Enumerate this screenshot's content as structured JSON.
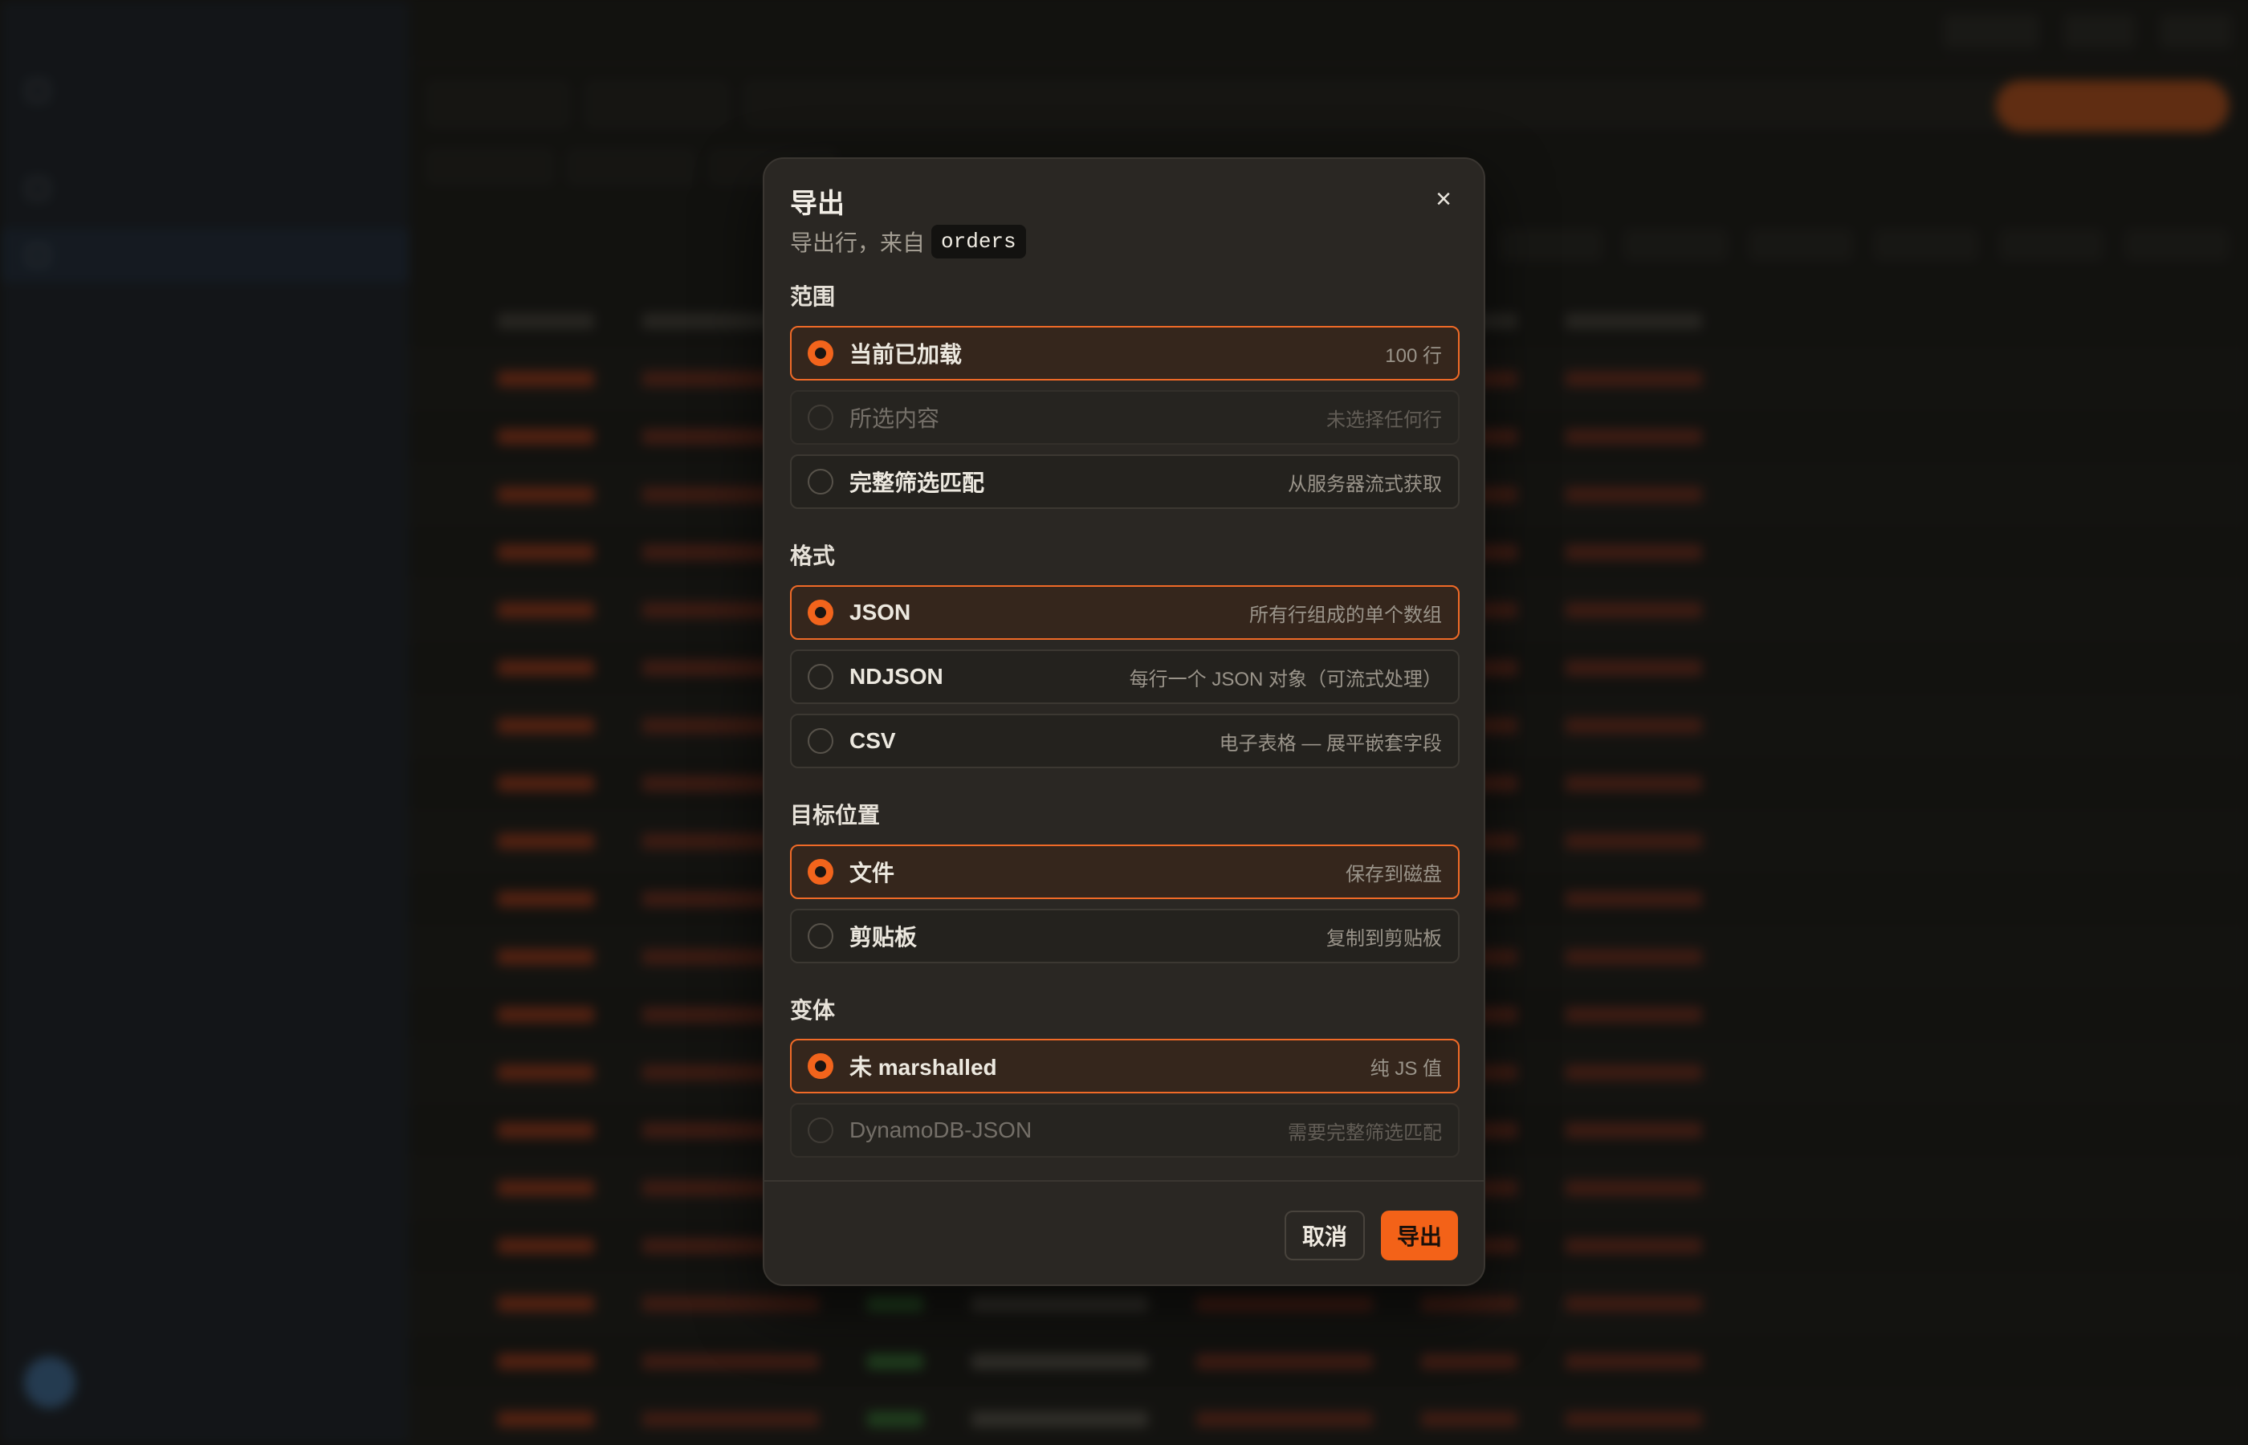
{
  "modal": {
    "title": "导出",
    "subtitle_prefix": "导出行，来自",
    "table_name": "orders",
    "close_icon": "×",
    "sections": {
      "scope": {
        "title": "范围",
        "options": [
          {
            "label": "当前已加载",
            "desc": "100 行",
            "selected": true,
            "disabled": false
          },
          {
            "label": "所选内容",
            "desc": "未选择任何行",
            "selected": false,
            "disabled": true
          },
          {
            "label": "完整筛选匹配",
            "desc": "从服务器流式获取",
            "selected": false,
            "disabled": false
          }
        ]
      },
      "format": {
        "title": "格式",
        "options": [
          {
            "label": "JSON",
            "desc": "所有行组成的单个数组",
            "selected": true,
            "disabled": false
          },
          {
            "label": "NDJSON",
            "desc": "每行一个 JSON 对象（可流式处理）",
            "selected": false,
            "disabled": false
          },
          {
            "label": "CSV",
            "desc": "电子表格 — 展平嵌套字段",
            "selected": false,
            "disabled": false
          }
        ]
      },
      "destination": {
        "title": "目标位置",
        "options": [
          {
            "label": "文件",
            "desc": "保存到磁盘",
            "selected": true,
            "disabled": false
          },
          {
            "label": "剪贴板",
            "desc": "复制到剪贴板",
            "selected": false,
            "disabled": false
          }
        ]
      },
      "variant": {
        "title": "变体",
        "options": [
          {
            "label": "未 marshalled",
            "desc": "纯 JS 值",
            "selected": true,
            "disabled": false
          },
          {
            "label": "DynamoDB-JSON",
            "desc": "需要完整筛选匹配",
            "selected": false,
            "disabled": true
          }
        ]
      }
    },
    "footer": {
      "cancel_label": "取消",
      "export_label": "导出"
    }
  },
  "colors": {
    "accent": "#f36218",
    "modal_bg": "#2a2723",
    "sidebar_bg": "#1d2430"
  }
}
